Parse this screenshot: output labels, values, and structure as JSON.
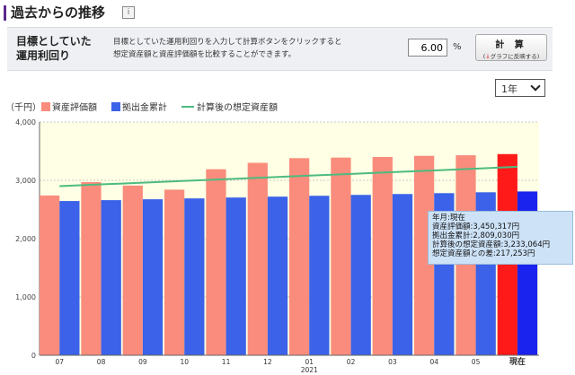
{
  "section": {
    "title": "過去からの推移",
    "info_icon": "info-icon"
  },
  "calc": {
    "label_line1": "目標としていた",
    "label_line2": "運用利回り",
    "desc_line1": "目標としていた運用利回りを入力して計算ボタンをクリックすると",
    "desc_line2": "想定資産額と資産評価額を比較することができます。",
    "rate_value": "6.00",
    "rate_unit": "%",
    "button_label": "計 算",
    "button_sub": "グラフに反映する",
    "button_sub_icon": "down-arrow-icon"
  },
  "period": {
    "selected": "1年"
  },
  "colors": {
    "asset": "#f98c7c",
    "contrib": "#3b62e8",
    "line": "#4cbb7f",
    "current_asset": "#ff1a1a",
    "current_contrib": "#1a22ee",
    "plot_bg": "#ffffe5"
  },
  "tooltip": {
    "line1": "年月:現在",
    "line2": "資産評価額:3,450,317円",
    "line3": "拠出金累計:2,809,030円",
    "line4": "計算後の想定資産額:3,233,064円",
    "line5": "想定資産額との差:217,253円"
  },
  "chart_data": {
    "type": "bar",
    "unit_label": "（千円）",
    "categories": [
      "07",
      "08",
      "09",
      "10",
      "11",
      "12",
      "01",
      "02",
      "03",
      "04",
      "05",
      "現在"
    ],
    "year_label": {
      "text": "2021",
      "under": "01"
    },
    "ylim": [
      0,
      4000
    ],
    "yticks": [
      "0",
      "1,000",
      "2,000",
      "3,000",
      "4,000"
    ],
    "ytick_values": [
      0,
      1000,
      2000,
      3000,
      4000
    ],
    "grid": true,
    "legend_position": "top-left",
    "series": [
      {
        "name": "資産評価額",
        "kind": "bar",
        "values": [
          2740,
          2970,
          2910,
          2840,
          3190,
          3300,
          3380,
          3390,
          3400,
          3420,
          3430,
          3450
        ]
      },
      {
        "name": "拠出金累計",
        "kind": "bar",
        "values": [
          2645,
          2660,
          2675,
          2690,
          2705,
          2720,
          2735,
          2750,
          2765,
          2780,
          2795,
          2809
        ]
      },
      {
        "name": "計算後の想定資産額",
        "kind": "line",
        "values": [
          2900,
          2930,
          2960,
          2990,
          3020,
          3050,
          3080,
          3110,
          3140,
          3170,
          3200,
          3233
        ]
      }
    ]
  }
}
